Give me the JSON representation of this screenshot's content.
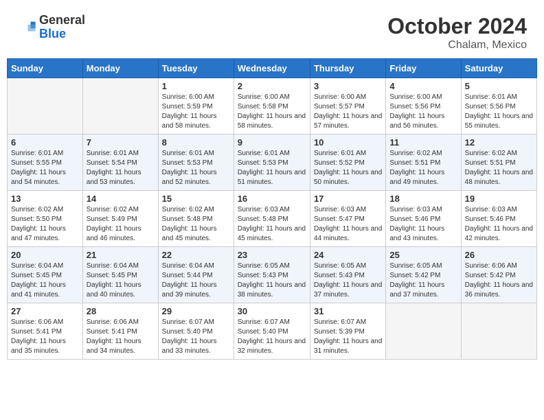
{
  "header": {
    "logo": {
      "general": "General",
      "blue": "Blue"
    },
    "month": "October 2024",
    "location": "Chalam, Mexico"
  },
  "weekdays": [
    "Sunday",
    "Monday",
    "Tuesday",
    "Wednesday",
    "Thursday",
    "Friday",
    "Saturday"
  ],
  "weeks": [
    [
      {
        "day": "",
        "empty": true
      },
      {
        "day": "",
        "empty": true
      },
      {
        "day": "1",
        "sunrise": "Sunrise: 6:00 AM",
        "sunset": "Sunset: 5:59 PM",
        "daylight": "Daylight: 11 hours and 58 minutes."
      },
      {
        "day": "2",
        "sunrise": "Sunrise: 6:00 AM",
        "sunset": "Sunset: 5:58 PM",
        "daylight": "Daylight: 11 hours and 58 minutes."
      },
      {
        "day": "3",
        "sunrise": "Sunrise: 6:00 AM",
        "sunset": "Sunset: 5:57 PM",
        "daylight": "Daylight: 11 hours and 57 minutes."
      },
      {
        "day": "4",
        "sunrise": "Sunrise: 6:00 AM",
        "sunset": "Sunset: 5:56 PM",
        "daylight": "Daylight: 11 hours and 56 minutes."
      },
      {
        "day": "5",
        "sunrise": "Sunrise: 6:01 AM",
        "sunset": "Sunset: 5:56 PM",
        "daylight": "Daylight: 11 hours and 55 minutes."
      }
    ],
    [
      {
        "day": "6",
        "sunrise": "Sunrise: 6:01 AM",
        "sunset": "Sunset: 5:55 PM",
        "daylight": "Daylight: 11 hours and 54 minutes."
      },
      {
        "day": "7",
        "sunrise": "Sunrise: 6:01 AM",
        "sunset": "Sunset: 5:54 PM",
        "daylight": "Daylight: 11 hours and 53 minutes."
      },
      {
        "day": "8",
        "sunrise": "Sunrise: 6:01 AM",
        "sunset": "Sunset: 5:53 PM",
        "daylight": "Daylight: 11 hours and 52 minutes."
      },
      {
        "day": "9",
        "sunrise": "Sunrise: 6:01 AM",
        "sunset": "Sunset: 5:53 PM",
        "daylight": "Daylight: 11 hours and 51 minutes."
      },
      {
        "day": "10",
        "sunrise": "Sunrise: 6:01 AM",
        "sunset": "Sunset: 5:52 PM",
        "daylight": "Daylight: 11 hours and 50 minutes."
      },
      {
        "day": "11",
        "sunrise": "Sunrise: 6:02 AM",
        "sunset": "Sunset: 5:51 PM",
        "daylight": "Daylight: 11 hours and 49 minutes."
      },
      {
        "day": "12",
        "sunrise": "Sunrise: 6:02 AM",
        "sunset": "Sunset: 5:51 PM",
        "daylight": "Daylight: 11 hours and 48 minutes."
      }
    ],
    [
      {
        "day": "13",
        "sunrise": "Sunrise: 6:02 AM",
        "sunset": "Sunset: 5:50 PM",
        "daylight": "Daylight: 11 hours and 47 minutes."
      },
      {
        "day": "14",
        "sunrise": "Sunrise: 6:02 AM",
        "sunset": "Sunset: 5:49 PM",
        "daylight": "Daylight: 11 hours and 46 minutes."
      },
      {
        "day": "15",
        "sunrise": "Sunrise: 6:02 AM",
        "sunset": "Sunset: 5:48 PM",
        "daylight": "Daylight: 11 hours and 45 minutes."
      },
      {
        "day": "16",
        "sunrise": "Sunrise: 6:03 AM",
        "sunset": "Sunset: 5:48 PM",
        "daylight": "Daylight: 11 hours and 45 minutes."
      },
      {
        "day": "17",
        "sunrise": "Sunrise: 6:03 AM",
        "sunset": "Sunset: 5:47 PM",
        "daylight": "Daylight: 11 hours and 44 minutes."
      },
      {
        "day": "18",
        "sunrise": "Sunrise: 6:03 AM",
        "sunset": "Sunset: 5:46 PM",
        "daylight": "Daylight: 11 hours and 43 minutes."
      },
      {
        "day": "19",
        "sunrise": "Sunrise: 6:03 AM",
        "sunset": "Sunset: 5:46 PM",
        "daylight": "Daylight: 11 hours and 42 minutes."
      }
    ],
    [
      {
        "day": "20",
        "sunrise": "Sunrise: 6:04 AM",
        "sunset": "Sunset: 5:45 PM",
        "daylight": "Daylight: 11 hours and 41 minutes."
      },
      {
        "day": "21",
        "sunrise": "Sunrise: 6:04 AM",
        "sunset": "Sunset: 5:45 PM",
        "daylight": "Daylight: 11 hours and 40 minutes."
      },
      {
        "day": "22",
        "sunrise": "Sunrise: 6:04 AM",
        "sunset": "Sunset: 5:44 PM",
        "daylight": "Daylight: 11 hours and 39 minutes."
      },
      {
        "day": "23",
        "sunrise": "Sunrise: 6:05 AM",
        "sunset": "Sunset: 5:43 PM",
        "daylight": "Daylight: 11 hours and 38 minutes."
      },
      {
        "day": "24",
        "sunrise": "Sunrise: 6:05 AM",
        "sunset": "Sunset: 5:43 PM",
        "daylight": "Daylight: 11 hours and 37 minutes."
      },
      {
        "day": "25",
        "sunrise": "Sunrise: 6:05 AM",
        "sunset": "Sunset: 5:42 PM",
        "daylight": "Daylight: 11 hours and 37 minutes."
      },
      {
        "day": "26",
        "sunrise": "Sunrise: 6:06 AM",
        "sunset": "Sunset: 5:42 PM",
        "daylight": "Daylight: 11 hours and 36 minutes."
      }
    ],
    [
      {
        "day": "27",
        "sunrise": "Sunrise: 6:06 AM",
        "sunset": "Sunset: 5:41 PM",
        "daylight": "Daylight: 11 hours and 35 minutes."
      },
      {
        "day": "28",
        "sunrise": "Sunrise: 6:06 AM",
        "sunset": "Sunset: 5:41 PM",
        "daylight": "Daylight: 11 hours and 34 minutes."
      },
      {
        "day": "29",
        "sunrise": "Sunrise: 6:07 AM",
        "sunset": "Sunset: 5:40 PM",
        "daylight": "Daylight: 11 hours and 33 minutes."
      },
      {
        "day": "30",
        "sunrise": "Sunrise: 6:07 AM",
        "sunset": "Sunset: 5:40 PM",
        "daylight": "Daylight: 11 hours and 32 minutes."
      },
      {
        "day": "31",
        "sunrise": "Sunrise: 6:07 AM",
        "sunset": "Sunset: 5:39 PM",
        "daylight": "Daylight: 11 hours and 31 minutes."
      },
      {
        "day": "",
        "empty": true
      },
      {
        "day": "",
        "empty": true
      }
    ]
  ]
}
